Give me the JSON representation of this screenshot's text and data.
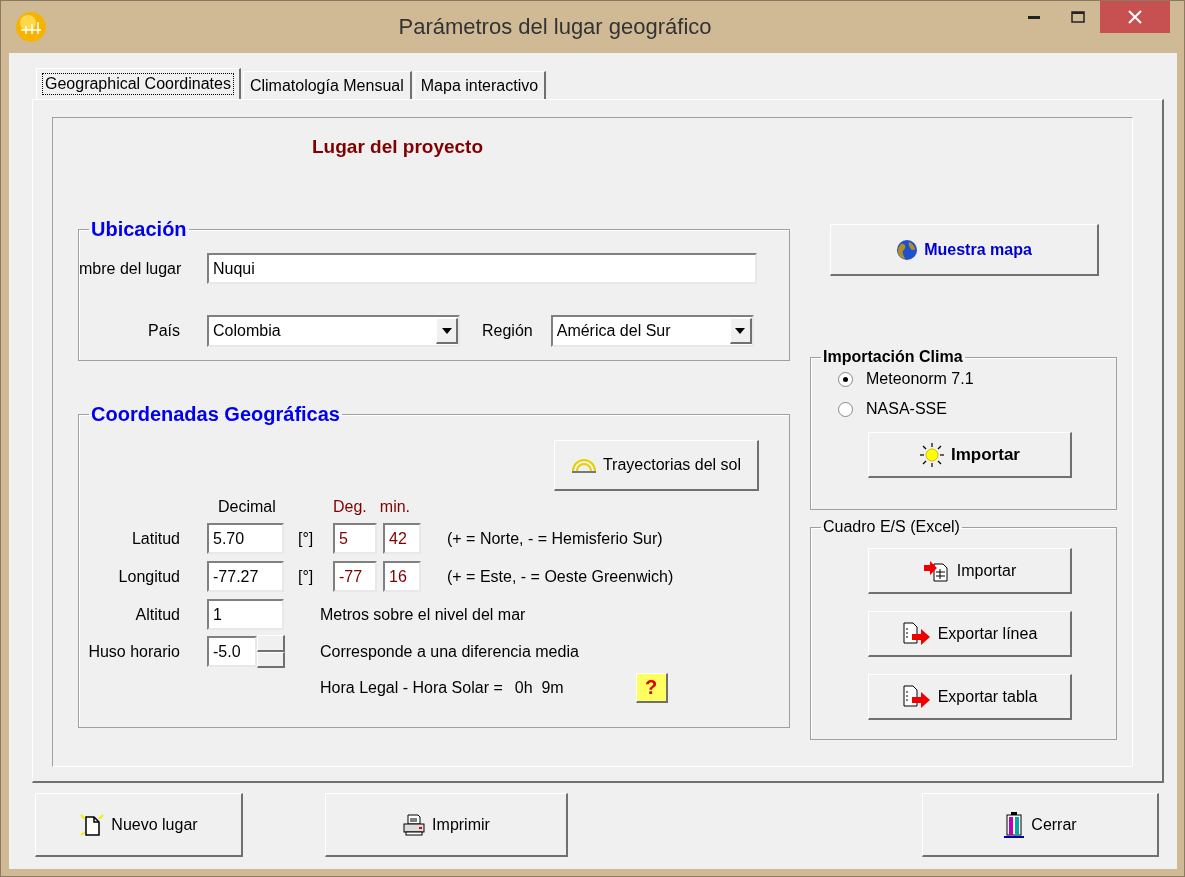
{
  "window": {
    "title": "Parámetros del lugar geográfico"
  },
  "tabs": [
    {
      "label": "Geographical Coordinates",
      "selected": true
    },
    {
      "label": "Climatología Mensual",
      "selected": false
    },
    {
      "label": "Mapa interactivo",
      "selected": false
    }
  ],
  "heading": "Lugar del proyecto",
  "location": {
    "legend": "Ubicación",
    "name_label": "mbre del lugar",
    "name_value": "Nuqui",
    "country_label": "País",
    "country_value": "Colombia",
    "region_label": "Región",
    "region_value": "América del Sur"
  },
  "map_button": "Muestra mapa",
  "coordinates": {
    "legend": "Coordenadas Geográficas",
    "sun_paths_button": "Trayectorias del sol",
    "col_decimal": "Decimal",
    "col_deg": "Deg.",
    "col_min": "min.",
    "rows": [
      {
        "kind": "angle",
        "label": "Latitud",
        "decimal": "5.70",
        "unit": "[°]",
        "deg": "5",
        "min": "42",
        "note": "(+ = Norte, - = Hemisferio Sur)"
      },
      {
        "kind": "angle",
        "label": "Longitud",
        "decimal": "-77.27",
        "unit": "[°]",
        "deg": "-77",
        "min": "16",
        "note": "(+ = Este, - = Oeste Greenwich)"
      },
      {
        "kind": "plain",
        "label": "Altitud",
        "decimal": "1",
        "note": "Metros sobre el nivel del mar"
      },
      {
        "kind": "spin",
        "label": "Huso horario",
        "decimal": "-5.0",
        "note": "Corresponde a una diferencia media"
      }
    ],
    "solar_label": "Hora Legal - Hora Solar =",
    "solar_value": "0h  9m",
    "help_button": "?"
  },
  "climate_import": {
    "legend": "Importación Clima",
    "options": [
      {
        "label": "Meteonorm 7.1",
        "selected": true
      },
      {
        "label": "NASA-SSE",
        "selected": false
      }
    ],
    "button": "Importar"
  },
  "excel": {
    "legend": "Cuadro E/S (Excel)",
    "buttons": [
      {
        "label": "Importar",
        "kind": "import"
      },
      {
        "label": "Exportar línea",
        "kind": "export"
      },
      {
        "label": "Exportar tabla",
        "kind": "export"
      }
    ]
  },
  "footer_buttons": [
    {
      "label": "Nuevo lugar",
      "kind": "new"
    },
    {
      "label": "Imprimir",
      "kind": "print"
    },
    {
      "label": "Cerrar",
      "kind": "close"
    }
  ]
}
